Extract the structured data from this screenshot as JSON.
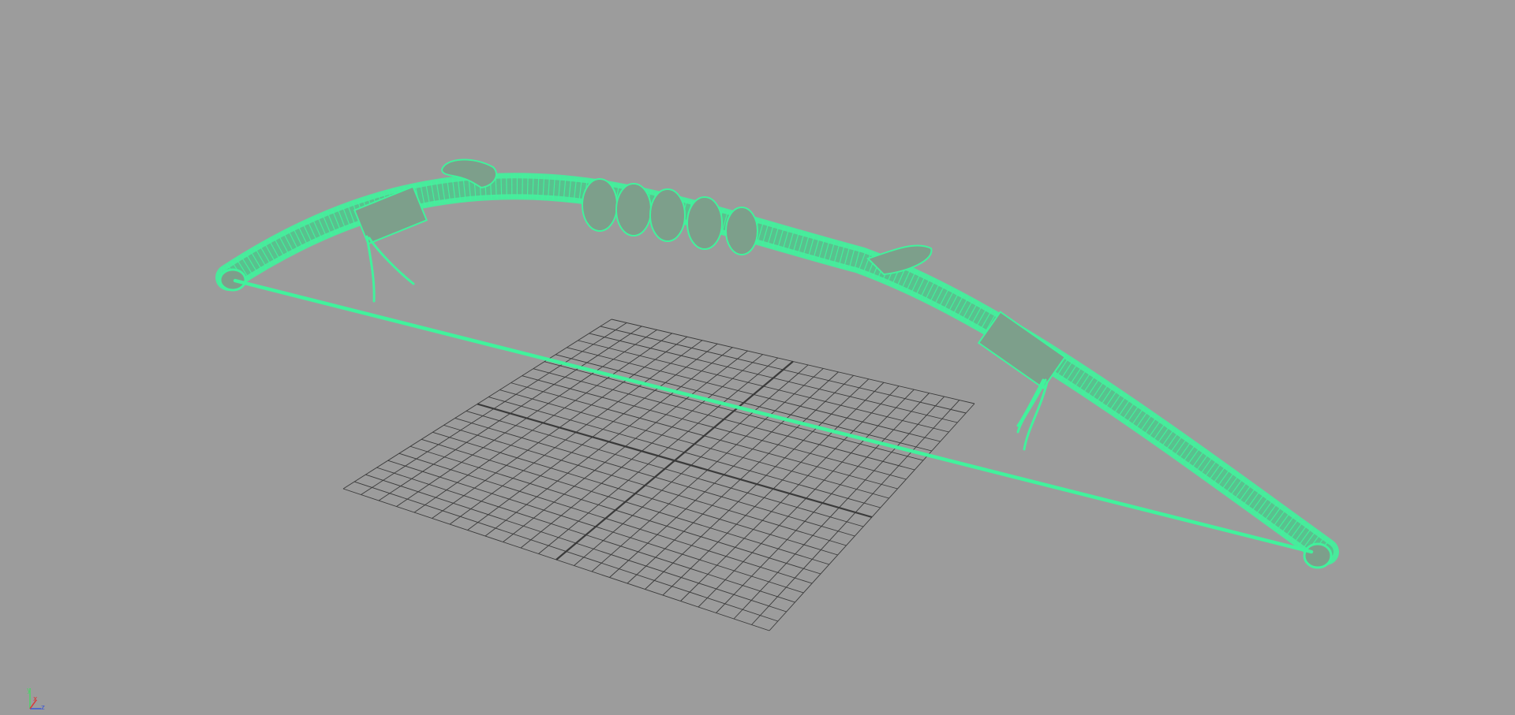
{
  "viewport": {
    "background": "#9c9c9c",
    "wire_color": "#41f29c",
    "grid_color": "#3a3a3a"
  },
  "axis_gizmo": {
    "y_label": "y",
    "x_label": "x",
    "z_label": "z",
    "y_color": "#4fd16a",
    "x_color": "#d83a3a",
    "z_color": "#3a56d8"
  },
  "scene": {
    "selected_object": "bow",
    "grid_visible": true
  }
}
